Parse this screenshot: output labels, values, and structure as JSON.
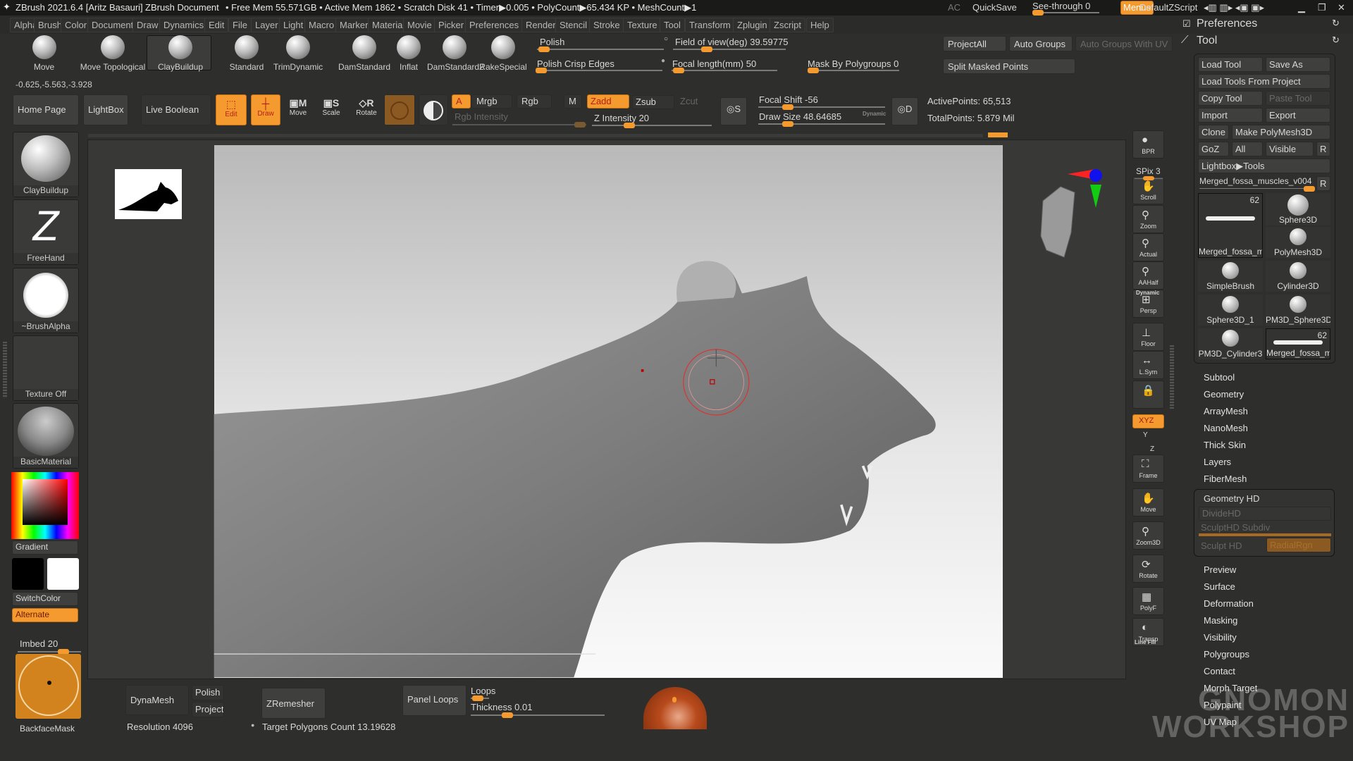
{
  "title": {
    "app": "ZBrush 2021.6.4 [Aritz Basauri]",
    "doc": "ZBrush Document",
    "stats": "• Free Mem 55.571GB • Active Mem 1862 • Scratch Disk 41 • Timer▶0.005 • PolyCount▶65.434 KP • MeshCount▶1",
    "ac": "AC",
    "quicksave": "QuickSave",
    "seethrough": "See-through  0",
    "menus": "Menus",
    "script": "DefaultZScript"
  },
  "menu": [
    "Alpha",
    "Brush",
    "Color",
    "Document",
    "Draw",
    "Dynamics",
    "Edit",
    "File",
    "Layer",
    "Light",
    "Macro",
    "Marker",
    "Material",
    "Movie",
    "Picker",
    "Preferences",
    "Render",
    "Stencil",
    "Stroke",
    "Texture",
    "Tool",
    "Transform",
    "Zplugin",
    "Zscript",
    "Help"
  ],
  "brushes": [
    "Move",
    "Move Topological",
    "ClayBuildup",
    "Standard",
    "TrimDynamic",
    "DamStandard",
    "Inflat",
    "DamStandard2",
    "RakeSpecial"
  ],
  "coords": "-0.625,-5.563,-3.928",
  "top": {
    "polish": "Polish",
    "fov": "Field of view(deg) 39.59775",
    "polish_crisp": "Polish Crisp Edges",
    "focal_len": "Focal length(mm) 50",
    "mask_pg": "Mask By Polygroups 0",
    "projectall": "ProjectAll",
    "autogroups": "Auto Groups",
    "autogroups_uv": "Auto Groups With UV",
    "split": "Split Masked Points"
  },
  "row2": {
    "home": "Home Page",
    "lightbox": "LightBox",
    "liveboolean": "Live Boolean",
    "edit": "Edit",
    "draw": "Draw",
    "move": "Move",
    "scale": "Scale",
    "rotate": "Rotate",
    "a": "A",
    "mrgb": "Mrgb",
    "rgb": "Rgb",
    "m": "M",
    "zadd": "Zadd",
    "zsub": "Zsub",
    "zcut": "Zcut",
    "rgb_int": "Rgb Intensity",
    "z_int": "Z Intensity 20",
    "focal_shift": "Focal Shift -56",
    "draw_size": "Draw Size 48.64685",
    "dynamic": "Dynamic",
    "active_points": "ActivePoints: 65,513",
    "total_points": "TotalPoints: 5.879 Mil",
    "s": "S",
    "d": "D"
  },
  "left": {
    "brush": "ClayBuildup",
    "stroke": "FreeHand",
    "alpha": "~BrushAlpha",
    "texture": "Texture Off",
    "material": "BasicMaterial",
    "gradient": "Gradient",
    "switchcolor": "SwitchColor",
    "alternate": "Alternate",
    "imbed": "Imbed 20",
    "backface": "BackfaceMask"
  },
  "shelf": {
    "bpr": "BPR",
    "spix": "SPix 3",
    "scroll": "Scroll",
    "zoom": "Zoom",
    "actual": "Actual",
    "aahalf": "AAHalf",
    "dynamic": "Dynamic",
    "persp": "Persp",
    "floor": "Floor",
    "lsym": "L.Sym",
    "xyz": "XYZ",
    "y": "Y",
    "z": "Z",
    "frame": "Frame",
    "move": "Move",
    "zoom3d": "Zoom3D",
    "rotate": "Rotate",
    "linefill": "Line Fill",
    "polyf": "PolyF",
    "transp": "Transp"
  },
  "tray": {
    "preferences": "Preferences",
    "tool": "Tool",
    "load_tool": "Load Tool",
    "save_as": "Save As",
    "load_project": "Load Tools From Project",
    "copy_tool": "Copy Tool",
    "paste_tool": "Paste Tool",
    "import": "Import",
    "export": "Export",
    "clone": "Clone",
    "make_polymesh": "Make PolyMesh3D",
    "goz": "GoZ",
    "all": "All",
    "visible": "Visible",
    "r": "R",
    "lightbox_tools": "Lightbox▶Tools",
    "current_tool": "Merged_fossa_muscles_v004",
    "tiles": [
      {
        "label": "Merged_fossa_m",
        "count": "62"
      },
      {
        "label": "Sphere3D"
      },
      {
        "label": "PolyMesh3D"
      },
      {
        "label": "SimpleBrush"
      },
      {
        "label": "Cylinder3D"
      },
      {
        "label": "Sphere3D_1"
      },
      {
        "label": "PM3D_Sphere3D"
      },
      {
        "label": "PM3D_Cylinder3"
      },
      {
        "label": "Merged_fossa_m",
        "count": "62"
      }
    ],
    "sections_a": [
      "Subtool",
      "Geometry",
      "ArrayMesh",
      "NanoMesh",
      "Thick Skin",
      "Layers",
      "FiberMesh"
    ],
    "geohd": {
      "title": "Geometry HD",
      "divide": "DivideHD",
      "subdiv": "SculptHD Subdiv",
      "sculpt": "Sculpt HD",
      "radial": "RadialRgn"
    },
    "sections_b": [
      "Preview",
      "Surface",
      "Deformation",
      "Masking",
      "Visibility",
      "Polygroups",
      "Contact",
      "Morph Target",
      "Polypaint",
      "UV Map"
    ]
  },
  "bottom": {
    "dynamesh": "DynaMesh",
    "polish": "Polish",
    "project": "Project",
    "resolution": "Resolution 4096",
    "zremesher": "ZRemesher",
    "target": "Target Polygons Count 13.19628",
    "panel_loops": "Panel Loops",
    "loops": "Loops",
    "thickness": "Thickness 0.01"
  },
  "watermark": "THE GNOMON WORKSHOP",
  "colors": {
    "accent": "#f59a2e",
    "bg": "#2e2f2d",
    "primary_color": "#000000",
    "secondary_color": "#ffffff"
  }
}
